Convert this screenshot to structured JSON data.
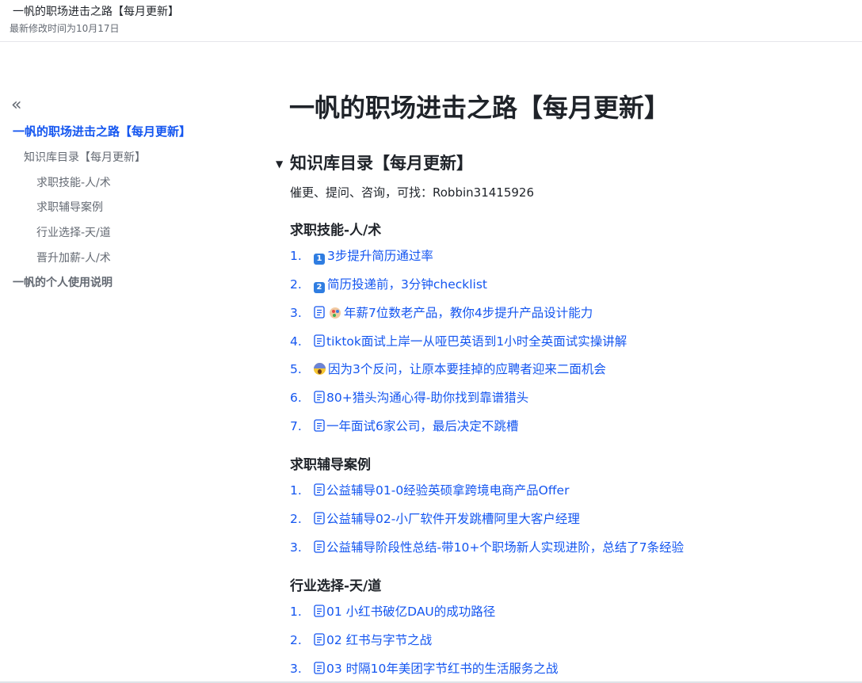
{
  "header": {
    "title": "一帆的职场进击之路【每月更新】",
    "modified": "最新修改时间为10月17日"
  },
  "sidebar": {
    "collapse_glyph": "«",
    "items": [
      {
        "label": "一帆的职场进击之路【每月更新】"
      },
      {
        "label": "知识库目录【每月更新】"
      },
      {
        "label": "求职技能-人/术"
      },
      {
        "label": "求职辅导案例"
      },
      {
        "label": "行业选择-天/道"
      },
      {
        "label": "晋升加薪-人/术"
      },
      {
        "label": "一帆的个人使用说明"
      }
    ]
  },
  "main": {
    "title": "一帆的职场进击之路【每月更新】",
    "section_toggle": "▼",
    "section_heading": "知识库目录【每月更新】",
    "contact": "催更、提问、咨询，可找：Robbin31415926",
    "groups": [
      {
        "heading": "求职技能-人/术",
        "items": [
          {
            "num": "1.",
            "icon": "keycap-1",
            "keycap": "1",
            "text": "3步提升简历通过率"
          },
          {
            "num": "2.",
            "icon": "keycap-2",
            "keycap": "2",
            "text": "简历投递前，3分钟checklist"
          },
          {
            "num": "3.",
            "icon": "doc-icon palette-emoji",
            "text": "年薪7位数老产品，教你4步提升产品设计能力"
          },
          {
            "num": "4.",
            "icon": "doc-icon",
            "text": "tiktok面试上岸一从哑巴英语到1小时全英面试实操讲解"
          },
          {
            "num": "5.",
            "icon": "scream-emoji",
            "text": "因为3个反问，让原本要挂掉的应聘者迎来二面机会"
          },
          {
            "num": "6.",
            "icon": "doc-icon",
            "text": "80+猎头沟通心得-助你找到靠谱猎头"
          },
          {
            "num": "7.",
            "icon": "doc-icon",
            "text": "一年面试6家公司，最后决定不跳槽"
          }
        ]
      },
      {
        "heading": "求职辅导案例",
        "items": [
          {
            "num": "1.",
            "icon": "doc-icon",
            "text": "公益辅导01-0经验英硕拿跨境电商产品Offer"
          },
          {
            "num": "2.",
            "icon": "doc-icon",
            "text": "公益辅导02-小厂软件开发跳槽阿里大客户经理"
          },
          {
            "num": "3.",
            "icon": "doc-icon",
            "text": "公益辅导阶段性总结-带10+个职场新人实现进阶，总结了7条经验"
          }
        ]
      },
      {
        "heading": "行业选择-天/道",
        "items": [
          {
            "num": "1.",
            "icon": "doc-icon",
            "text": "01 小红书破亿DAU的成功路径"
          },
          {
            "num": "2.",
            "icon": "doc-icon",
            "text": "02 红书与字节之战"
          },
          {
            "num": "3.",
            "icon": "doc-icon",
            "text": "03 时隔10年美团字节红书的生活服务之战"
          }
        ]
      }
    ]
  },
  "colors": {
    "link": "#1456f0",
    "text": "#1f2329",
    "muted": "#646a73"
  }
}
